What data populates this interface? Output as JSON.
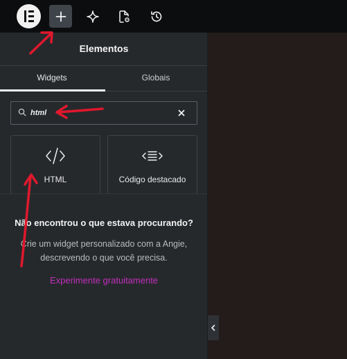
{
  "topbar": {
    "logo_icon": "elementor-logo-icon",
    "buttons": [
      {
        "name": "add-element-icon",
        "active": true
      },
      {
        "name": "ai-sparkle-icon",
        "active": false
      },
      {
        "name": "page-settings-icon",
        "active": false
      },
      {
        "name": "history-icon",
        "active": false
      }
    ]
  },
  "panel": {
    "title": "Elementos",
    "tabs": [
      "Widgets",
      "Globais"
    ],
    "active_tab": "Widgets",
    "search": {
      "value": "html",
      "placeholder": ""
    },
    "widgets": [
      {
        "label": "HTML",
        "icon": "code-icon"
      },
      {
        "label": "Código destacado",
        "icon": "code-highlight-icon"
      }
    ],
    "not_found": {
      "title": "Não encontrou o que estava procurando?",
      "line1": "Crie um widget personalizado com a Angie,",
      "line2": "descrevendo o que você precisa.",
      "cta": "Experimente gratuitamente"
    }
  },
  "colors": {
    "accent": "#c32fbd",
    "annotation_arrow": "#e0182d",
    "topbar_bg": "#0c0d0e",
    "panel_bg": "#26292c",
    "canvas_bg": "#241b1b"
  }
}
